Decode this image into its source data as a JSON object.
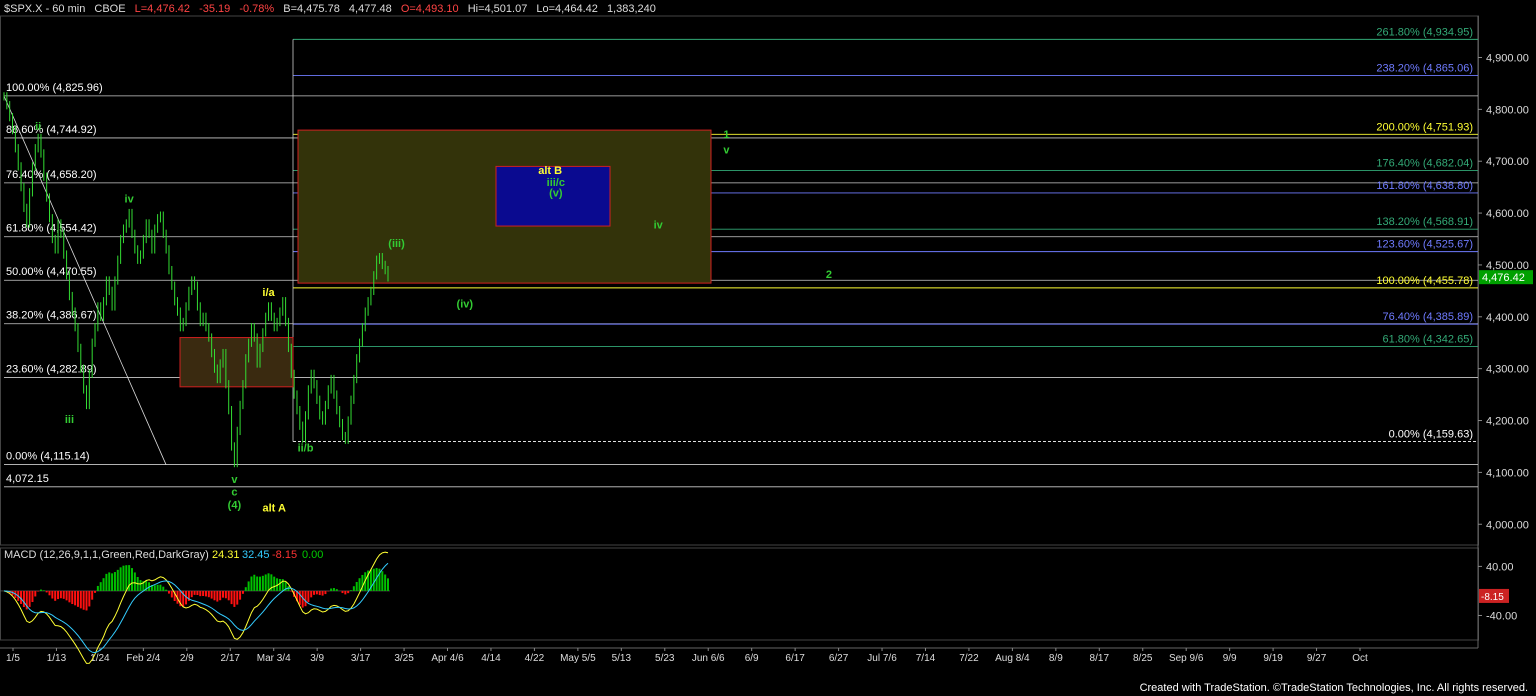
{
  "header": {
    "symbol": "$SPX.X - 60 min",
    "exchange": "CBOE",
    "last": "L=4,476.42",
    "change": "-35.19",
    "change_pct": "-0.78%",
    "bid": "B=4,475.78",
    "ask": "4,477.48",
    "open": "O=4,493.10",
    "high": "Hi=4,501.07",
    "low": "Lo=4,464.42",
    "volume": "1,383,240"
  },
  "footer": {
    "text": "Created with TradeStation. ©TradeStation Technologies, Inc. All rights reserved."
  },
  "colors": {
    "background": "#000000",
    "grid": "#1d2a1d",
    "price_tag": "#00a000",
    "fib_left": "#ffffff",
    "fib_right": "#6f7bff",
    "fib_green": "#33aa77",
    "yellow": "#ffff33",
    "wave_green": "#33cc33",
    "macd_green": "#00c000",
    "macd_red": "#ff1111"
  },
  "chart_data": [
    {
      "type": "line",
      "title": "$SPX.X - 60 min",
      "y_ticks": [
        "4,900.00",
        "4,800.00",
        "4,700.00",
        "4,600.00",
        "4,500.00",
        "4,400.00",
        "4,300.00",
        "4,200.00",
        "4,100.00",
        "4,000.00"
      ],
      "ylim": [
        3960,
        4980
      ],
      "last_price": "4,476.42",
      "x_ticks": [
        "1/5",
        "1/13",
        "1/24",
        "Feb 2/4",
        "2/9",
        "2/17",
        "Mar 3/4",
        "3/9",
        "3/17",
        "3/25",
        "Apr 4/6",
        "4/14",
        "4/22",
        "May 5/5",
        "5/13",
        "5/23",
        "Jun 6/6",
        "6/9",
        "6/17",
        "6/27",
        "Jul 7/6",
        "7/14",
        "7/22",
        "Aug 8/4",
        "8/9",
        "8/17",
        "8/25",
        "Sep 9/6",
        "9/9",
        "9/19",
        "9/27",
        "Oct"
      ],
      "series": [
        {
          "values": [
            4825,
            4808,
            4785,
            4760,
            4725,
            4690,
            4650,
            4610,
            4580,
            4640,
            4690,
            4725,
            4745,
            4715,
            4670,
            4630,
            4590,
            4550,
            4530,
            4580,
            4560,
            4520,
            4480,
            4440,
            4410,
            4380,
            4340,
            4300,
            4260,
            4230,
            4290,
            4350,
            4380,
            4420,
            4400,
            4430,
            4470,
            4450,
            4420,
            4470,
            4510,
            4550,
            4570,
            4580,
            4600,
            4560,
            4530,
            4510,
            4520,
            4550,
            4580,
            4560,
            4530,
            4570,
            4590,
            4595,
            4560,
            4530,
            4490,
            4460,
            4430,
            4410,
            4380,
            4390,
            4420,
            4450,
            4470,
            4460,
            4420,
            4390,
            4400,
            4380,
            4360,
            4330,
            4300,
            4280,
            4310,
            4330,
            4270,
            4220,
            4150,
            4118,
            4180,
            4230,
            4270,
            4320,
            4350,
            4380,
            4360,
            4310,
            4340,
            4370,
            4400,
            4420,
            4400,
            4380,
            4390,
            4410,
            4430,
            4390,
            4340,
            4290,
            4250,
            4220,
            4190,
            4165,
            4210,
            4260,
            4290,
            4270,
            4240,
            4210,
            4200,
            4230,
            4260,
            4280,
            4250,
            4220,
            4195,
            4170,
            4163,
            4200,
            4240,
            4280,
            4320,
            4350,
            4380,
            4410,
            4430,
            4450,
            4480,
            4510,
            4515,
            4500,
            4490,
            4476
          ]
        }
      ],
      "fib_left": [
        {
          "label": "100.00% (4,825.96)",
          "value": 4825.96
        },
        {
          "label": "88.60% (4,744.92)",
          "value": 4744.92
        },
        {
          "label": "76.40% (4,658.20)",
          "value": 4658.2
        },
        {
          "label": "61.80% (4,554.42)",
          "value": 4554.42
        },
        {
          "label": "50.00% (4,470.55)",
          "value": 4470.55
        },
        {
          "label": "38.20% (4,386.67)",
          "value": 4386.67
        },
        {
          "label": "23.60% (4,282.89)",
          "value": 4282.89
        },
        {
          "label": "0.00% (4,115.14)",
          "value": 4115.14
        },
        {
          "label": "4,072.15",
          "value": 4072.15
        }
      ],
      "fib_right": [
        {
          "label": "261.80% (4,934.95)",
          "value": 4934.95,
          "color": "fib_green"
        },
        {
          "label": "238.20% (4,865.06)",
          "value": 4865.06,
          "color": "fib_right"
        },
        {
          "label": "200.00% (4,751.93)",
          "value": 4751.93,
          "color": "yellow"
        },
        {
          "label": "176.40% (4,682.04)",
          "value": 4682.04,
          "color": "fib_green"
        },
        {
          "label": "161.80% (4,638.80)",
          "value": 4638.8,
          "color": "fib_right"
        },
        {
          "label": "138.20% (4,568.91)",
          "value": 4568.91,
          "color": "fib_green"
        },
        {
          "label": "123.60% (4,525.67)",
          "value": 4525.67,
          "color": "fib_right"
        },
        {
          "label": "100.00% (4,455.78)",
          "value": 4455.78,
          "color": "yellow"
        },
        {
          "label": "76.40% (4,385.89)",
          "value": 4385.89,
          "color": "fib_right"
        },
        {
          "label": "61.80% (4,342.65)",
          "value": 4342.65,
          "color": "fib_green"
        },
        {
          "label": "0.00% (4,159.63)",
          "value": 4159.63,
          "color": "fib_left"
        }
      ],
      "wave_labels": [
        {
          "text": "ii",
          "color": "wave_green",
          "bar": 12,
          "value": 4760
        },
        {
          "text": "iii",
          "color": "wave_green",
          "bar": 23,
          "value": 4195
        },
        {
          "text": "iv",
          "color": "wave_green",
          "bar": 44,
          "value": 4620
        },
        {
          "text": "v",
          "color": "wave_green",
          "bar": 81,
          "value": 4080
        },
        {
          "text": "c",
          "color": "wave_green",
          "bar": 81,
          "value": 4055
        },
        {
          "text": "(4)",
          "color": "wave_green",
          "bar": 81,
          "value": 4030
        },
        {
          "text": "alt A",
          "color": "yellow",
          "bar": 95,
          "value": 4025
        },
        {
          "text": "i/a",
          "color": "yellow",
          "bar": 93,
          "value": 4440
        },
        {
          "text": "ii/b",
          "color": "wave_green",
          "bar": 106,
          "value": 4140
        },
        {
          "text": "(iii)",
          "color": "wave_green",
          "bar": 138,
          "value": 4535
        },
        {
          "text": "(iv)",
          "color": "wave_green",
          "bar": 162,
          "value": 4418
        },
        {
          "text": "alt B",
          "color": "yellow",
          "bar": 192,
          "value": 4675
        },
        {
          "text": "iii/c",
          "color": "wave_green",
          "bar": 194,
          "value": 4652
        },
        {
          "text": "(v)",
          "color": "wave_green",
          "bar": 194,
          "value": 4632
        },
        {
          "text": "iv",
          "color": "wave_green",
          "bar": 230,
          "value": 4570
        },
        {
          "text": "1",
          "color": "wave_green",
          "bar": 254,
          "value": 4745
        },
        {
          "text": "v",
          "color": "wave_green",
          "bar": 254,
          "value": 4715
        },
        {
          "text": "2",
          "color": "wave_green",
          "bar": 290,
          "value": 4475
        }
      ]
    },
    {
      "type": "bar",
      "title": "MACD (12,26,9,1,1,Green,Red,DarkGray)",
      "values_text": [
        "24.31",
        "32.45",
        "-8.15",
        "0.00"
      ],
      "y_ticks": [
        "40.00",
        "-40.00"
      ],
      "last_value": "-8.15",
      "ylim": [
        -80,
        70
      ]
    }
  ]
}
